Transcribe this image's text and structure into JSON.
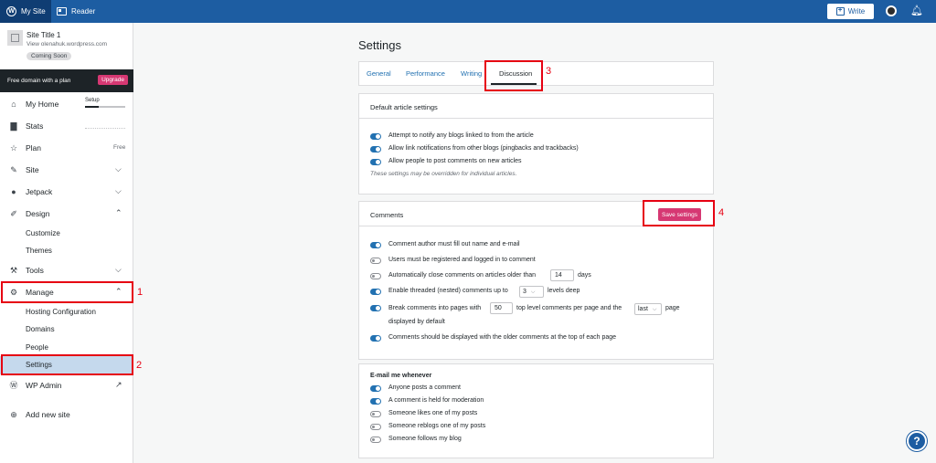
{
  "topbar": {
    "my_site": "My Site",
    "reader": "Reader",
    "write": "Write"
  },
  "site": {
    "title": "Site Title 1",
    "url": "View olenahuk.wordpress.com",
    "badge": "Coming Soon"
  },
  "promo": {
    "text": "Free domain with a plan",
    "button": "Upgrade"
  },
  "nav": {
    "my_home": "My Home",
    "setup": "Setup",
    "stats": "Stats",
    "plan": "Plan",
    "plan_value": "Free",
    "site": "Site",
    "jetpack": "Jetpack",
    "design": "Design",
    "customize": "Customize",
    "themes": "Themes",
    "tools": "Tools",
    "manage": "Manage",
    "hosting": "Hosting Configuration",
    "domains": "Domains",
    "people": "People",
    "settings": "Settings",
    "wp_admin": "WP Admin",
    "add_site": "Add new site"
  },
  "annotations": [
    "1",
    "2",
    "3",
    "4"
  ],
  "main": {
    "title": "Settings",
    "tabs": [
      "General",
      "Performance",
      "Writing",
      "Discussion"
    ],
    "default_article": {
      "header": "Default article settings",
      "options": [
        {
          "label": "Attempt to notify any blogs linked to from the article",
          "on": true
        },
        {
          "label": "Allow link notifications from other blogs (pingbacks and trackbacks)",
          "on": true
        },
        {
          "label": "Allow people to post comments on new articles",
          "on": true
        }
      ],
      "note": "These settings may be overridden for individual articles."
    },
    "comments": {
      "header": "Comments",
      "save": "Save settings",
      "opt1": "Comment author must fill out name and e-mail",
      "opt2": "Users must be registered and logged in to comment",
      "opt3a": "Automatically close comments on articles older than",
      "opt3_value": "14",
      "opt3b": "days",
      "opt4a": "Enable threaded (nested) comments up to",
      "opt4_value": "3",
      "opt4b": "levels deep",
      "opt5a": "Break comments into pages with",
      "opt5_value": "50",
      "opt5b": "top level comments per page and the",
      "opt5_select": "last",
      "opt5c": "page",
      "opt5d": "displayed by default",
      "opt6": "Comments should be displayed with the older comments at the top of each page"
    },
    "email": {
      "header": "E-mail me whenever",
      "options": [
        {
          "label": "Anyone posts a comment",
          "on": true
        },
        {
          "label": "A comment is held for moderation",
          "on": true
        },
        {
          "label": "Someone likes one of my posts",
          "on": false
        },
        {
          "label": "Someone reblogs one of my posts",
          "on": false
        },
        {
          "label": "Someone follows my blog",
          "on": false
        }
      ]
    }
  },
  "colors": {
    "topbar": "#1d5da2",
    "accent": "#d63873",
    "toggle_on": "#2271b1",
    "annotation": "#e60012"
  }
}
